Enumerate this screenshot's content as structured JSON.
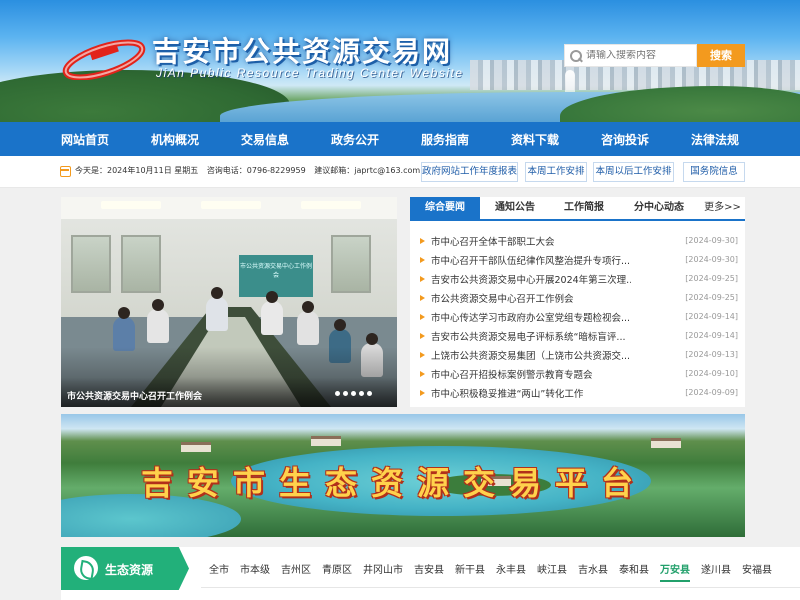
{
  "header": {
    "title": "吉安市公共资源交易网",
    "subtitle": "JiAn Public Resource Trading Center Website",
    "search_placeholder": "请输入搜索内容",
    "search_button": "搜索"
  },
  "nav": {
    "items": [
      "网站首页",
      "机构概况",
      "交易信息",
      "政务公开",
      "服务指南",
      "资料下载",
      "咨询投诉",
      "法律法规"
    ]
  },
  "infobar": {
    "date_text": "今天是：2024年10月11日 星期五",
    "phone_text": "咨询电话：0796-8229959",
    "email_text": "建议邮箱：japrtc@163.com",
    "quick_links": [
      "政府网站工作年度报表",
      "本周工作安排",
      "本周以后工作安排",
      "国务院信息"
    ]
  },
  "slider": {
    "caption": "市公共资源交易中心召开工作例会",
    "screen_text": "市公共资源交易中心工作例会",
    "dot_count": 5
  },
  "news": {
    "tabs": [
      "综合要闻",
      "通知公告",
      "工作简报",
      "分中心动态",
      "更多>>"
    ],
    "items": [
      {
        "title": "市中心召开全体干部职工大会",
        "date": "[2024-09-30]"
      },
      {
        "title": "市中心召开干部队伍纪律作风整治提升专项行...",
        "date": "[2024-09-30]"
      },
      {
        "title": "吉安市公共资源交易中心开展2024年第三次理...",
        "date": "[2024-09-25]"
      },
      {
        "title": "市公共资源交易中心召开工作例会",
        "date": "[2024-09-25]"
      },
      {
        "title": "市中心传达学习市政府办公室党组专题检视会...",
        "date": "[2024-09-14]"
      },
      {
        "title": "吉安市公共资源交易电子评标系统“暗标盲评...",
        "date": "[2024-09-14]"
      },
      {
        "title": "上饶市公共资源交易集团（上饶市公共资源交...",
        "date": "[2024-09-13]"
      },
      {
        "title": "市中心召开招投标案例警示教育专题会",
        "date": "[2024-09-10]"
      },
      {
        "title": "市中心积极稳妥推进“两山”转化工作",
        "date": "[2024-09-09]"
      }
    ]
  },
  "banner": {
    "title": "吉安市生态资源交易平台"
  },
  "eco": {
    "label": "生态资源",
    "areas": [
      "全市",
      "市本级",
      "吉州区",
      "青原区",
      "井冈山市",
      "吉安县",
      "新干县",
      "永丰县",
      "峡江县",
      "吉水县",
      "泰和县",
      "万安县",
      "遂川县",
      "安福县"
    ],
    "active_index": 11
  },
  "colors": {
    "brand_blue": "#1a73c9",
    "accent_orange": "#f39a1e",
    "eco_green": "#22b07a"
  }
}
